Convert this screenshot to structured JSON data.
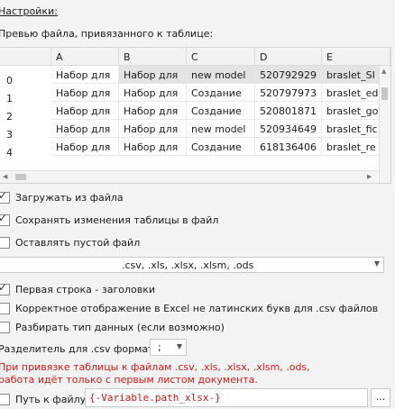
{
  "settings": {
    "title": "Настройки:",
    "preview_label": "Превью файла, привязанного к таблице:"
  },
  "grid": {
    "columns": [
      "A",
      "B",
      "C",
      "D",
      "E"
    ],
    "rows": [
      {
        "index": "0",
        "cells": [
          "Набор для",
          "Набор для",
          "new model",
          "520792929",
          "braslet_SI"
        ]
      },
      {
        "index": "1",
        "cells": [
          "Набор для",
          "Набор для",
          "Создание",
          "520797973",
          "braslet_ed"
        ]
      },
      {
        "index": "2",
        "cells": [
          "Набор для",
          "Набор для",
          "Создание",
          "520801871",
          "braslet_go"
        ]
      },
      {
        "index": "3",
        "cells": [
          "Набор для",
          "Набор для",
          "new model",
          "520934649",
          "braslet_fic"
        ]
      },
      {
        "index": "4",
        "cells": [
          "Набор для",
          "Набор для",
          "Создание",
          "618136406",
          "braslet_re"
        ]
      }
    ]
  },
  "options": {
    "load_from_file": {
      "label": "Загружать из файла",
      "checked": true
    },
    "save_changes": {
      "label": "Сохранять изменения таблицы в файл",
      "checked": true
    },
    "leave_empty": {
      "label": "Оставлять пустой файл",
      "checked": false
    },
    "file_types": ".csv, .xls, .xlsx, .xlsm, .ods",
    "first_row_headers": {
      "label": "Первая строка - заголовки",
      "checked": true
    },
    "correct_display": {
      "label": "Корректное отображение в Excel не латинских букв для .csv файлов",
      "checked": false
    },
    "parse_types": {
      "label": "Разбирать тип данных (если возможно)",
      "checked": false
    },
    "separator_label": "Разделитель для .csv формата",
    "separator_value": ";",
    "warning": "При привязке таблицы к файлам .csv, .xls, .xlsx, .xlsm, .ods, работа идёт только с первым листом документа.",
    "path_label": "Путь к файлу",
    "path_value": "{-Variable.path_xlsx-}",
    "browse_label": "..."
  },
  "colors": {
    "warning": "#d01818",
    "variable": "#1e64b4"
  }
}
